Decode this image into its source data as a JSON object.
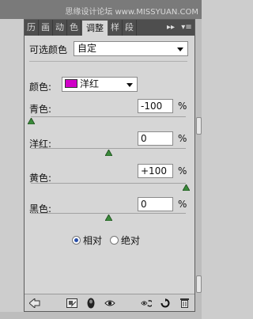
{
  "watermark": "思缘设计论坛 www.MISSYUAN.COM",
  "tabs": [
    "历",
    "画",
    "动",
    "色",
    "调整",
    "样",
    "段"
  ],
  "tab_controls": [
    "▸▸",
    "▾≡"
  ],
  "preset": {
    "label": "可选颜色",
    "value": "自定"
  },
  "colors": {
    "label": "颜色:",
    "value": "洋红",
    "swatch": "#d000c8"
  },
  "sliders": [
    {
      "label": "青色:",
      "value": "-100",
      "unit": "%",
      "fraction": 0.0
    },
    {
      "label": "洋红:",
      "value": "0",
      "unit": "%",
      "fraction": 0.5
    },
    {
      "label": "黄色:",
      "value": "+100",
      "unit": "%",
      "fraction": 1.0
    },
    {
      "label": "黑色:",
      "value": "0",
      "unit": "%",
      "fraction": 0.5
    }
  ],
  "method": {
    "relative": "相对",
    "absolute": "绝对",
    "selected": "relative"
  },
  "footer_icons": [
    "back-arrow-icon",
    "clip-layer-icon",
    "eye-mask-icon",
    "eye-icon",
    "view-previous-icon",
    "reset-icon",
    "trash-icon"
  ]
}
